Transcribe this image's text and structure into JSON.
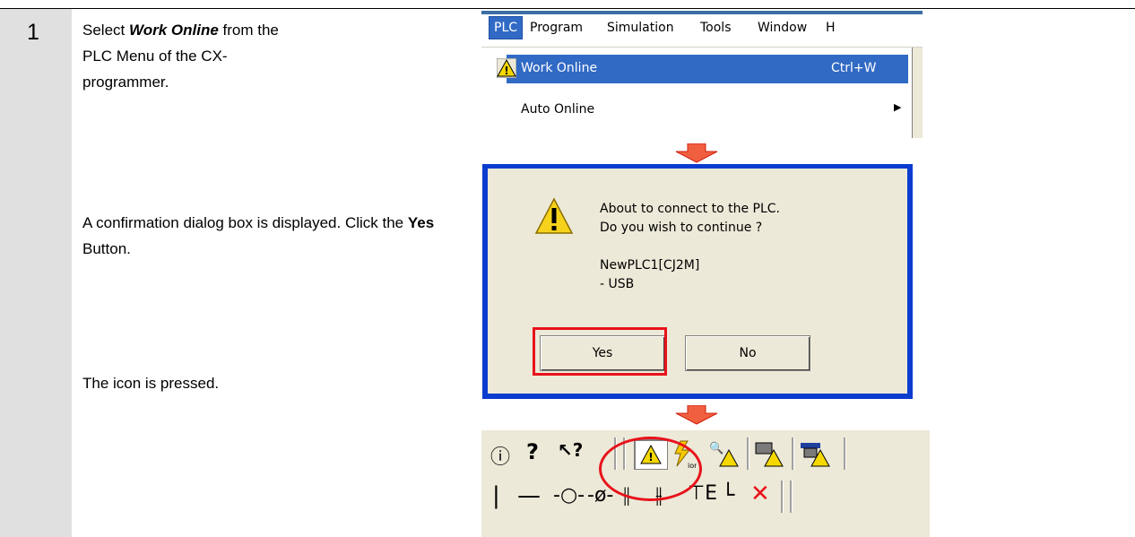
{
  "step_number": "1",
  "step1": {
    "pre": "Select ",
    "em": "Work Online",
    "post": " from the PLC Menu of the CX-programmer."
  },
  "step2": {
    "pre": "A confirmation dialog box is displayed. Click the ",
    "bold": "Yes",
    "post": " Button."
  },
  "step3": {
    "text": "The icon is pressed."
  },
  "menu": {
    "bar_items": [
      "PLC",
      "Program",
      "Simulation",
      "Tools",
      "Window",
      "H"
    ],
    "items": [
      {
        "label": "Work Online",
        "shortcut": "Ctrl+W",
        "icon": "warning-icon",
        "highlighted": true
      },
      {
        "label": "Auto Online",
        "has_submenu": true
      }
    ]
  },
  "dialog": {
    "icon": "warning-icon",
    "message_line1": "About to connect to the PLC.",
    "message_line2": "Do you wish to continue ?",
    "device_line1": "NewPLC1[CJ2M]",
    "device_line2": "- USB",
    "yes_label": "Yes",
    "no_label": "No"
  },
  "toolbar": {
    "row1_icons": [
      "info-icon",
      "help-icon",
      "context-help-icon",
      "work-online-icon",
      "online-edit-icon",
      "monitor-icon",
      "compare-icon",
      "transfer-icon"
    ],
    "row2_icons": [
      "vertical-line-icon",
      "horizontal-line-icon",
      "contact-icon",
      "closed-contact-icon",
      "new-rung-icon",
      "insert-rung-icon",
      "function-block-icon",
      "corner-icon",
      "delete-icon"
    ]
  },
  "colors": {
    "highlight_red": "#e8121b",
    "arrow_orange": "#f06040",
    "menu_highlight": "#316ac5",
    "dialog_border": "#0a3ccf",
    "step_column": "#e0e0e0"
  }
}
